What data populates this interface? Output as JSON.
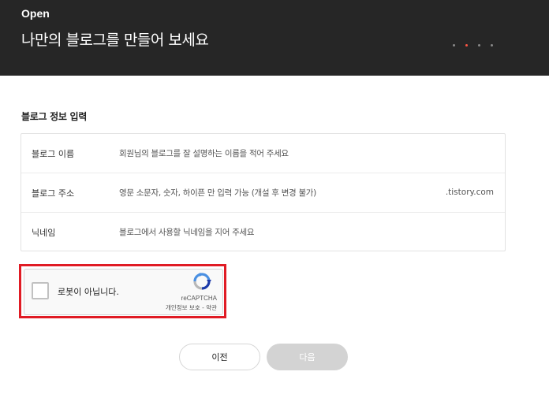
{
  "header": {
    "brand": "Open",
    "headline": "나만의 블로그를 만들어 보세요",
    "steps": {
      "total": 4,
      "current": 2
    }
  },
  "section": {
    "title": "블로그 정보 입력"
  },
  "form": {
    "rows": [
      {
        "label": "블로그 이름",
        "placeholder": "회원님의 블로그를 잘 설명하는 이름을 적어 주세요",
        "suffix": ""
      },
      {
        "label": "블로그 주소",
        "placeholder": "영문 소문자, 숫자, 하이픈 만 입력 가능 (개설 후 변경 불가)",
        "suffix": ".tistory.com"
      },
      {
        "label": "닉네임",
        "placeholder": "블로그에서 사용할 닉네임을 지어 주세요",
        "suffix": ""
      }
    ]
  },
  "recaptcha": {
    "label": "로봇이 아닙니다.",
    "brand": "reCAPTCHA",
    "links": "개인정보 보호 - 약관",
    "highlight_color": "#e01b24"
  },
  "buttons": {
    "prev": "이전",
    "next": "다음"
  },
  "colors": {
    "header_bg": "#262626",
    "active_step": "#ff5544",
    "next_disabled": "#d3d3d3"
  }
}
